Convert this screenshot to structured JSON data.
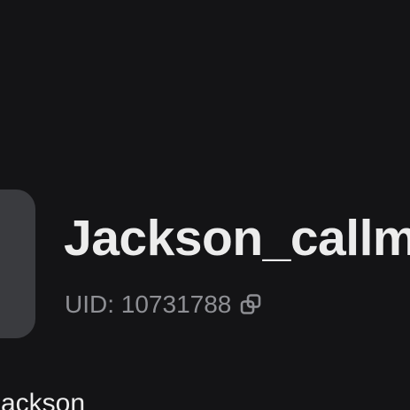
{
  "profile": {
    "username": "Jackson_callme",
    "uid_label": "UID: 10731788",
    "copy_icon": "copy-icon",
    "display_name": "Jackson"
  },
  "colors": {
    "background": "#141416",
    "avatar": "#3a3b3f",
    "primary_text": "#ececec",
    "secondary_text": "#8e8f94"
  }
}
